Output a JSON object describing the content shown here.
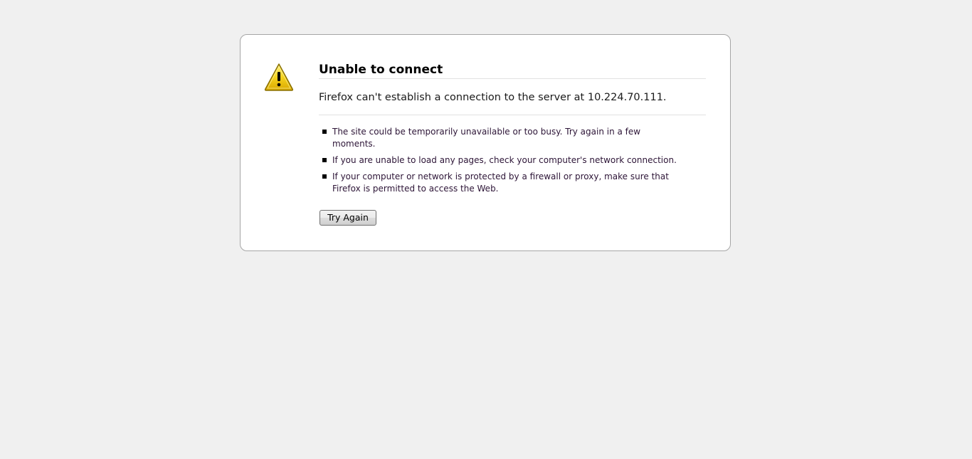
{
  "error": {
    "title": "Unable to connect",
    "short_desc": "Firefox can't establish a connection to the server at 10.224.70.111.",
    "items": [
      "The site could be temporarily unavailable or too busy. Try again in a few moments.",
      "If you are unable to load any pages, check your computer's network connection.",
      "If your computer or network is protected by a firewall or proxy, make sure that Firefox is permitted to access the Web."
    ],
    "try_again_label": "Try Again",
    "icon": "warning-icon"
  },
  "colors": {
    "page_background": "#f0f0f0",
    "box_background": "#ffffff",
    "box_border": "#a6a6a6",
    "warning_yellow": "#f5d21e"
  }
}
